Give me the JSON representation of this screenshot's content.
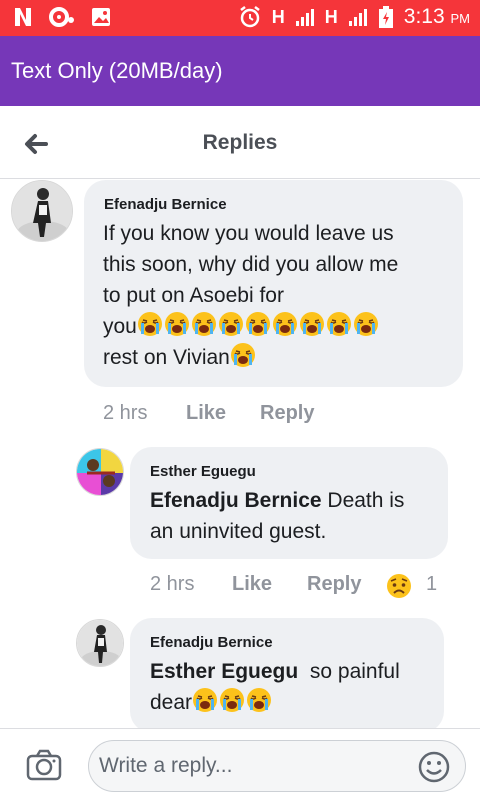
{
  "status_bar": {
    "time": "3:13",
    "ampm": "PM",
    "signal1": "H",
    "signal2": "H"
  },
  "app_bar": {
    "title": "Text Only (20MB/day)"
  },
  "header": {
    "title": "Replies"
  },
  "comments": [
    {
      "author": "Efenadju Bernice",
      "lines": [
        "If you know you would leave us",
        "this soon, why did you allow me",
        "to put on Asoebi for"
      ],
      "line4_text": "you",
      "line4_emoji_count": 9,
      "line5_text": "rest on Vivian",
      "time": "2 hrs",
      "like": "Like",
      "reply": "Reply"
    },
    {
      "author": "Esther Eguegu",
      "mention": "Efenadju Bernice",
      "text_after_mention": " Death is",
      "line2": "an uninvited guest.",
      "time": "2 hrs",
      "like": "Like",
      "reply": "Reply",
      "reaction_count": "1"
    },
    {
      "author": "Efenadju Bernice",
      "mention": "Esther Eguegu",
      "text_after_mention": "  so painful",
      "line2": "dear"
    }
  ],
  "composer": {
    "placeholder": "Write a reply..."
  },
  "colors": {
    "status_bar": "#f5353a",
    "app_bar": "#7637b8",
    "bubble": "#eef0f3",
    "meta": "#90949c"
  }
}
